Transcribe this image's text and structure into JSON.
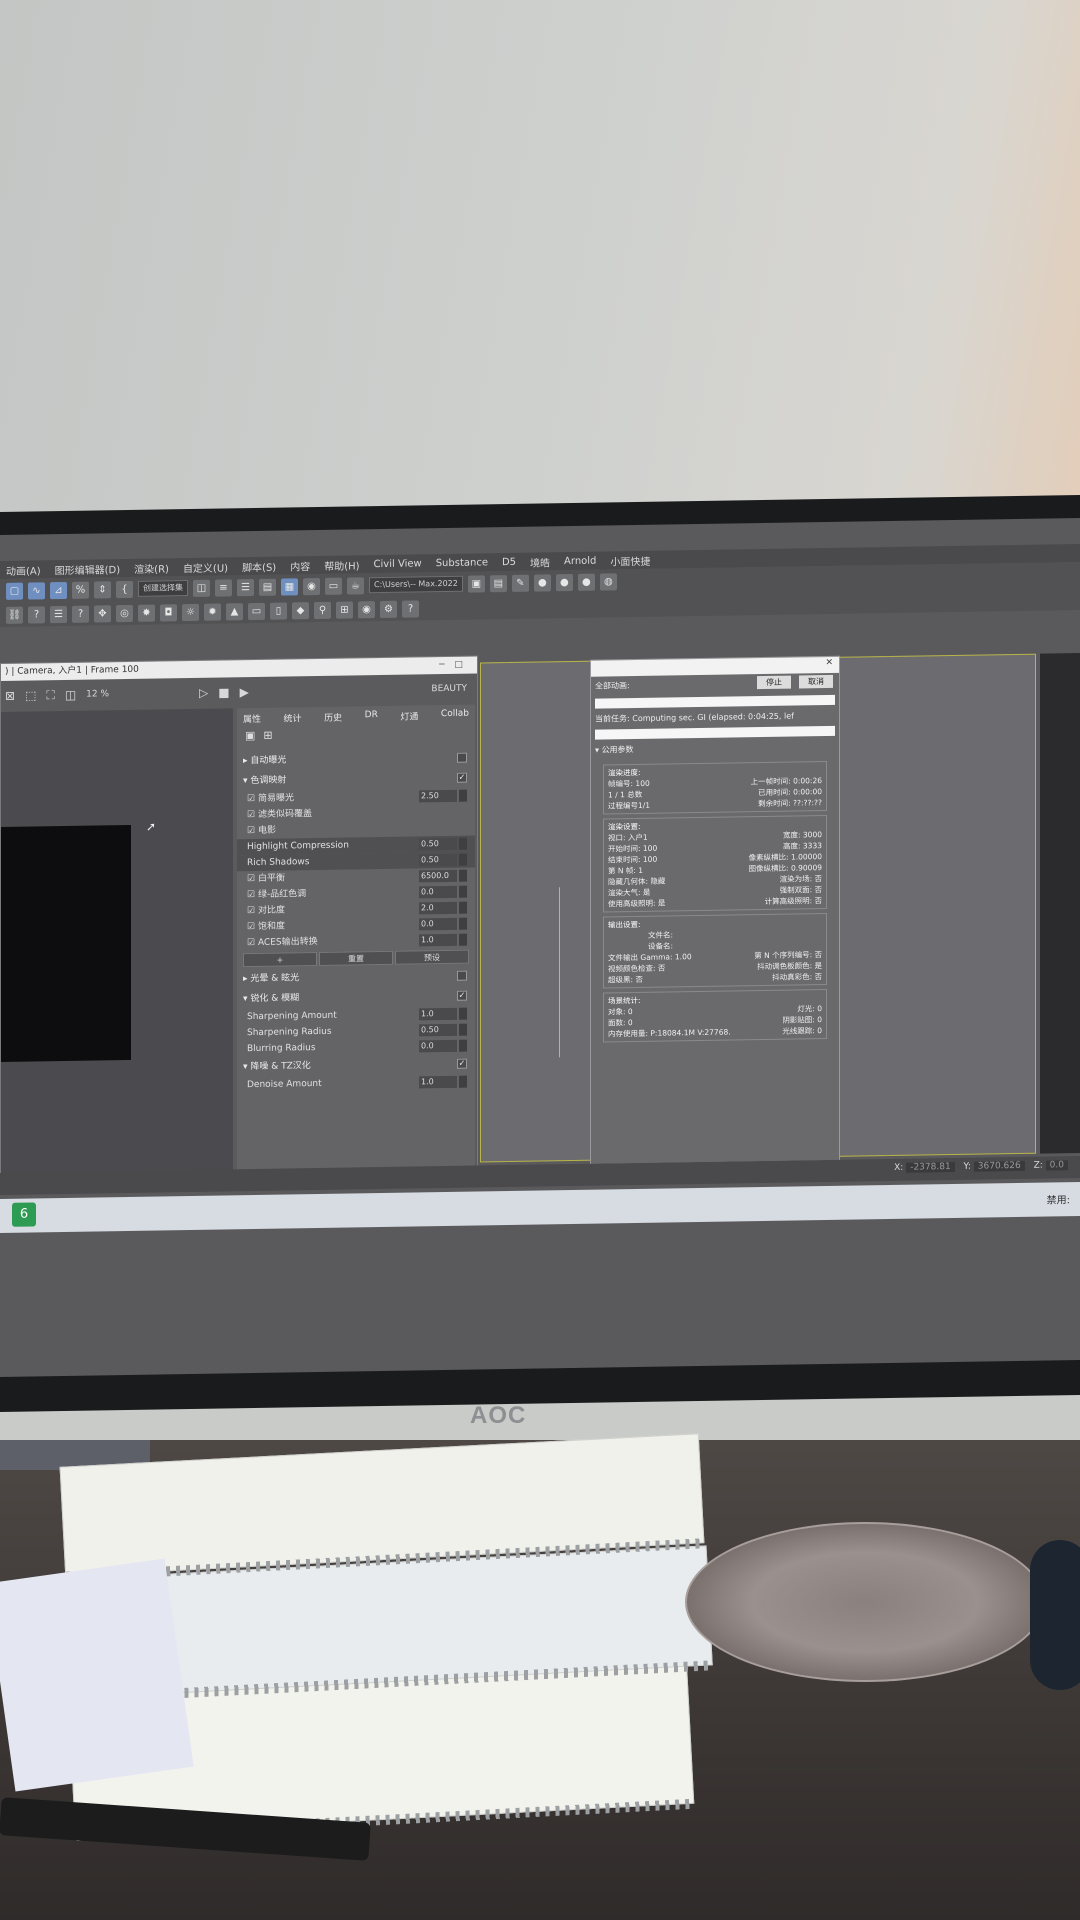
{
  "menubar": [
    "动画(A)",
    "图形编辑器(D)",
    "渲染(R)",
    "自定义(U)",
    "脚本(S)",
    "内容",
    "帮助(H)",
    "Civil View",
    "Substance",
    "D5",
    "境皓",
    "Arnold",
    "小面快捷"
  ],
  "toolbar": {
    "selection_set": "创建选择集",
    "path_dropdown": "C:\\Users\\-- Max.2022"
  },
  "vfb": {
    "title": ") | Camera, 入户1 | Frame 100",
    "zoom": "12 %",
    "channel": "BEAUTY",
    "tabs": [
      "属性",
      "统计",
      "历史",
      "DR",
      "灯通",
      "Collab"
    ],
    "sections": {
      "auto_exposure": "自动曝光",
      "color_mapping": "色调映射",
      "lens_effects": "光晕 & 眩光",
      "sharpen": "锐化 & 模糊",
      "denoise": "降噪 & TZ汉化"
    },
    "tone_rows": [
      {
        "label": "简易曝光",
        "value": "2.50"
      },
      {
        "label": "滤类似码覆盖",
        "value": ""
      },
      {
        "label": "电影",
        "value": ""
      },
      {
        "label": "Highlight Compression",
        "value": "0.50"
      },
      {
        "label": "Rich Shadows",
        "value": "0.50"
      },
      {
        "label": "白平衡",
        "value": "6500.0"
      },
      {
        "label": "绿-品红色调",
        "value": "0.0"
      },
      {
        "label": "对比度",
        "value": "2.0"
      },
      {
        "label": "饱和度",
        "value": "0.0"
      },
      {
        "label": "ACES输出转换",
        "value": "1.0"
      }
    ],
    "buttons": [
      "+",
      "重置",
      "预设"
    ],
    "sharpen_rows": [
      {
        "label": "Sharpening Amount",
        "value": "1.0"
      },
      {
        "label": "Sharpening Radius",
        "value": "0.50"
      },
      {
        "label": "Blurring Radius",
        "value": "0.0"
      }
    ],
    "denoise_rows": [
      {
        "label": "Denoise Amount",
        "value": "1.0"
      }
    ]
  },
  "render_dialog": {
    "all_anim": "全部动画:",
    "stop": "停止",
    "cancel": "取消",
    "current_task_label": "当前任务:",
    "current_task": "Computing sec. GI (elapsed: 0:04:25, lef",
    "common_params": "公用参数",
    "progress": {
      "heading": "渲染进度:",
      "frame_label": "帧编号:",
      "frame": "100",
      "last_frame_label": "上一帧时间:",
      "last_frame": "0:00:26",
      "count": "1 / 1",
      "total_label": "总数",
      "elapsed_label": "已用时间:",
      "elapsed": "0:00:00",
      "pass": "过程编号1/1",
      "remaining_label": "剩余时间:",
      "remaining": "??:??:??"
    },
    "settings": {
      "heading": "渲染设置:",
      "rows": [
        [
          "视口: 入户1",
          "宽度: 3000"
        ],
        [
          "开始时间: 100",
          "高度: 3333"
        ],
        [
          "结束时间: 100",
          "像素纵横比: 1.00000"
        ],
        [
          "第 N 帧: 1",
          "图像纵横比: 0.90009"
        ],
        [
          "隐藏几何体: 隐藏",
          "渲染为场: 否"
        ],
        [
          "渲染大气: 是",
          "强制双面: 否"
        ],
        [
          "使用高级照明: 是",
          "计算高级照明: 否"
        ]
      ]
    },
    "output": {
      "heading": "输出设置:",
      "file": "文件名:",
      "device": "设备名:",
      "rows": [
        [
          "文件输出 Gamma: 1.00",
          "第 N 个序列编号: 否"
        ],
        [
          "视频颜色检查: 否",
          "抖动调色板颜色: 是"
        ],
        [
          "超级黑: 否",
          "抖动真彩色: 否"
        ]
      ]
    },
    "scene": {
      "heading": "场景统计:",
      "rows": [
        [
          "对象: 0",
          "灯光: 0"
        ],
        [
          "面数: 0",
          "阴影贴图: 0"
        ],
        [
          "内存使用量: P:18084.1M V:27768.",
          "光线跟踪: 0"
        ]
      ]
    }
  },
  "statusbar": {
    "x_label": "X:",
    "x": "-2378.81",
    "y_label": "Y:",
    "y": "3670.626",
    "z_label": "Z:",
    "z": "0.0",
    "disabled": "禁用:"
  },
  "taskbar": {
    "app_icon": "6"
  },
  "monitor_brand": "AOC"
}
